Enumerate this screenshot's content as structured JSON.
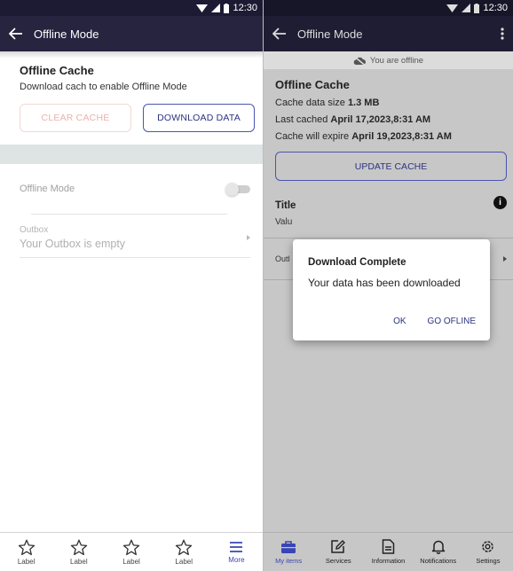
{
  "left": {
    "status_time": "12:30",
    "app_title": "Offline Mode",
    "section_title": "Offline Cache",
    "section_desc": "Download cach to enable Offline Mode",
    "clear_cache_label": "CLEAR CACHE",
    "download_data_label": "DOWNLOAD DATA",
    "offline_mode_label": "Offline Mode",
    "offline_mode_enabled": false,
    "outbox_label": "Outbox",
    "outbox_value": "Your Outbox is empty",
    "nav": [
      {
        "label": "Label",
        "icon": "star-outline-icon"
      },
      {
        "label": "Label",
        "icon": "star-outline-icon"
      },
      {
        "label": "Label",
        "icon": "star-outline-icon"
      },
      {
        "label": "Label",
        "icon": "star-outline-icon"
      },
      {
        "label": "More",
        "icon": "menu-icon",
        "active": true
      }
    ]
  },
  "right": {
    "status_time": "12:30",
    "app_title": "Offline Mode",
    "offline_banner": "You are offline",
    "section_title": "Offline Cache",
    "cache_size_prefix": "Cache data size ",
    "cache_size_value": "1.3 MB",
    "last_cached_prefix": "Last cached ",
    "last_cached_value": "April 17,2023,8:31 AM",
    "expire_prefix": "Cache will expire ",
    "expire_value": "April 19,2023,8:31 AM",
    "update_cache_label": "UPDATE CACHE",
    "title_label": "Title",
    "value_label": "Valu",
    "outbox_label": "Outl",
    "info_icon_glyph": "i",
    "dialog": {
      "title": "Download Complete",
      "message": "Your data has been downloaded",
      "ok_label": "OK",
      "go_offline_label": "GO OFLINE"
    },
    "nav": [
      {
        "label": "My items",
        "icon": "briefcase-icon",
        "active": true
      },
      {
        "label": "Services",
        "icon": "edit-icon"
      },
      {
        "label": "Information",
        "icon": "document-icon"
      },
      {
        "label": "Notifications",
        "icon": "bell-icon"
      },
      {
        "label": "Settings",
        "icon": "gear-icon"
      }
    ]
  },
  "colors": {
    "status_bar": "#1c1b33",
    "app_bar": "#26243f",
    "accent": "#3a45b5",
    "disabled_button_text": "#eab3aa",
    "overlay_background": "#c7c7c7"
  }
}
